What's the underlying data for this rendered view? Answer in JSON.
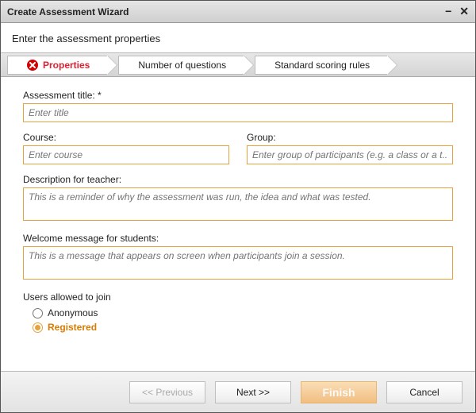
{
  "window": {
    "title": "Create Assessment Wizard"
  },
  "subhead": "Enter the assessment properties",
  "steps": {
    "s1": "Properties",
    "s2": "Number of questions",
    "s3": "Standard scoring rules"
  },
  "form": {
    "title_label": "Assessment title: *",
    "title_placeholder": "Enter title",
    "title_value": "",
    "course_label": "Course:",
    "course_placeholder": "Enter course",
    "course_value": "",
    "group_label": "Group:",
    "group_placeholder": "Enter group of participants (e.g. a class or a t...",
    "group_value": "",
    "desc_label": "Description for teacher:",
    "desc_placeholder": "This is a reminder of why the assessment was run, the idea and what was tested.",
    "desc_value": "",
    "welcome_label": "Welcome message for students:",
    "welcome_placeholder": "This is a message that appears on screen when participants join a session.",
    "welcome_value": "",
    "users_label": "Users allowed to join",
    "radio_anonymous": "Anonymous",
    "radio_registered": "Registered"
  },
  "buttons": {
    "previous": "<< Previous",
    "next": "Next >>",
    "finish": "Finish",
    "cancel": "Cancel"
  }
}
